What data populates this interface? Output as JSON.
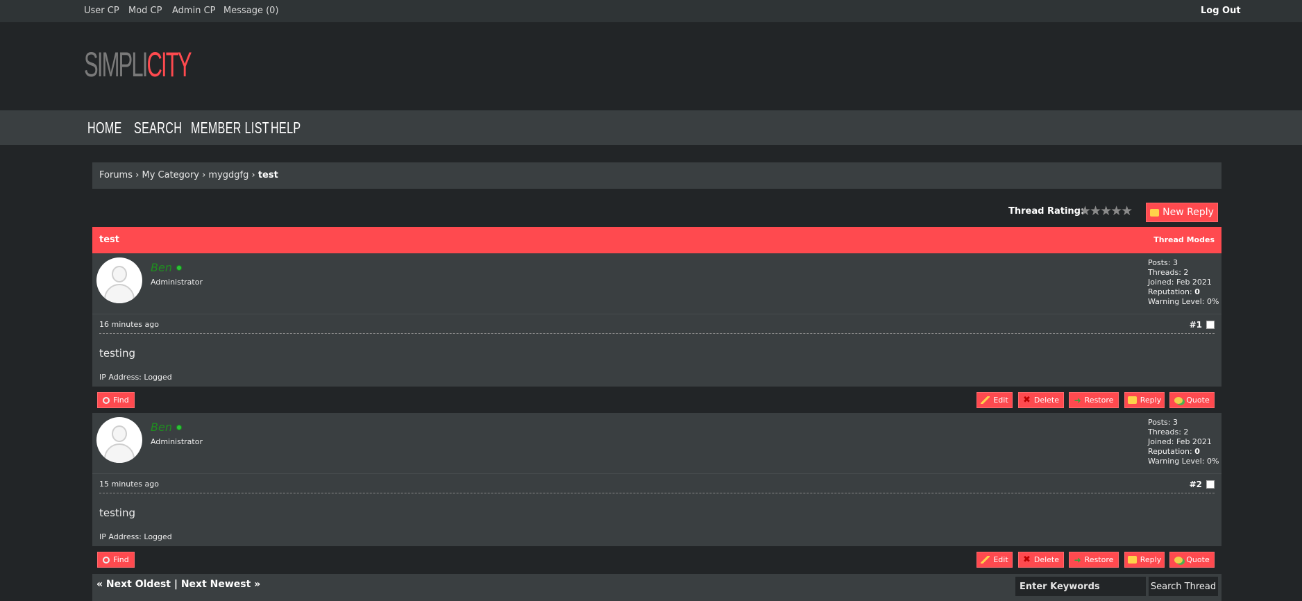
{
  "topbar": {
    "links": [
      "User CP",
      "Mod CP",
      "Admin CP",
      "Message (0)"
    ],
    "logout": "Log Out"
  },
  "logo": {
    "part1": "SIMPLI",
    "part2": "CITY"
  },
  "nav": [
    "HOME",
    "SEARCH",
    "MEMBER LIST",
    "HELP"
  ],
  "breadcrumb": {
    "items": [
      "Forums",
      "My Category",
      "mygdgfg"
    ],
    "current": "test",
    "sep": "›"
  },
  "thread": {
    "rating_label": "Thread Rating:",
    "stars": "★★★★★",
    "new_reply": "New Reply",
    "title": "test",
    "modes": "Thread Modes"
  },
  "posts": [
    {
      "username": "Ben",
      "role": "Administrator",
      "stats": {
        "posts": "Posts: 3",
        "threads": "Threads: 2",
        "joined": "Joined: Feb 2021",
        "rep_label": "Reputation:",
        "rep_value": "0",
        "warning": "Warning Level: 0%"
      },
      "date": "16 minutes ago",
      "number": "#1",
      "message": "testing",
      "ip": "IP Address: Logged"
    },
    {
      "username": "Ben",
      "role": "Administrator",
      "stats": {
        "posts": "Posts: 3",
        "threads": "Threads: 2",
        "joined": "Joined: Feb 2021",
        "rep_label": "Reputation:",
        "rep_value": "0",
        "warning": "Warning Level: 0%"
      },
      "date": "15 minutes ago",
      "number": "#2",
      "message": "testing",
      "ip": "IP Address: Logged"
    }
  ],
  "controls": {
    "find": "Find",
    "edit": "Edit",
    "delete": "Delete",
    "restore": "Restore",
    "reply": "Reply",
    "quote": "Quote"
  },
  "pagination": {
    "prev": "« Next Oldest",
    "sep": "|",
    "next": "Next Newest »"
  },
  "search": {
    "placeholder": "Enter Keywords",
    "button": "Search Thread"
  }
}
